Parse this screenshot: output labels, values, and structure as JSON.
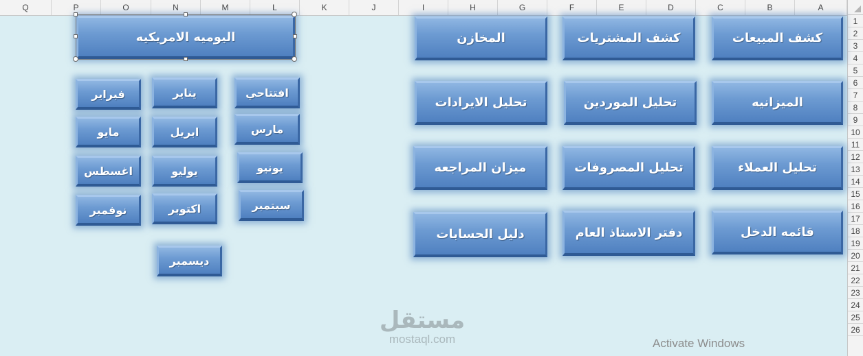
{
  "sheet": {
    "columns": [
      "Q",
      "P",
      "O",
      "N",
      "M",
      "L",
      "K",
      "J",
      "I",
      "H",
      "G",
      "F",
      "E",
      "D",
      "C",
      "B",
      "A"
    ],
    "rows": [
      "1",
      "2",
      "3",
      "4",
      "5",
      "6",
      "7",
      "8",
      "9",
      "10",
      "11",
      "12",
      "13",
      "14",
      "15",
      "16",
      "17",
      "18",
      "19",
      "20",
      "21",
      "22",
      "23",
      "24",
      "25",
      "26"
    ]
  },
  "right_panel": {
    "row1": [
      "كشف المبيعات",
      "كشف المشتريات",
      "المخازن"
    ],
    "row2": [
      "الميزانيه",
      "تحليل الموردين",
      "تحليل الايرادات"
    ],
    "row3": [
      "تحليل العملاء",
      "تحليل المصروفات",
      "ميزان المراجعه"
    ],
    "row4": [
      "قائمه الدخل",
      "دفتر الاستاذ العام",
      "دليل الحسابات"
    ]
  },
  "left_panel": {
    "title": "اليوميه الامريكيه",
    "months": [
      "افتتاحي",
      "يناير",
      "فبراير",
      "مارس",
      "ابريل",
      "مايو",
      "يونيو",
      "يوليو",
      "اغسطس",
      "سبتمبر",
      "اكتوبر",
      "نوفمبر",
      "ديسمبر"
    ]
  },
  "watermark": {
    "logo": "مستقل",
    "url": "mostaql.com"
  },
  "os_notice": "Activate Windows"
}
